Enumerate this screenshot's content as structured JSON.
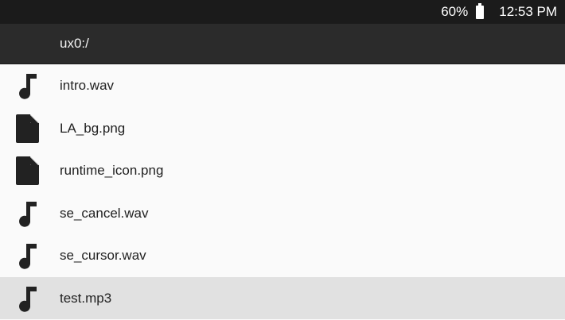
{
  "status_bar": {
    "battery_percent": "60%",
    "time": "12:53 PM",
    "battery_icon": "battery-icon"
  },
  "header": {
    "path": "ux0:/"
  },
  "files": [
    {
      "name": "intro.wav",
      "icon": "music-note-icon",
      "type": "audio",
      "selected": false
    },
    {
      "name": "LA_bg.png",
      "icon": "file-icon",
      "type": "file",
      "selected": false
    },
    {
      "name": "runtime_icon.png",
      "icon": "file-icon",
      "type": "file",
      "selected": false
    },
    {
      "name": "se_cancel.wav",
      "icon": "music-note-icon",
      "type": "audio",
      "selected": false
    },
    {
      "name": "se_cursor.wav",
      "icon": "music-note-icon",
      "type": "audio",
      "selected": false
    },
    {
      "name": "test.mp3",
      "icon": "music-note-icon",
      "type": "audio",
      "selected": true
    }
  ],
  "colors": {
    "status_bar_bg": "#1b1b1b",
    "title_bar_bg": "#2b2b2b",
    "list_bg": "#fafafa",
    "selected_row_bg": "#e1e1e1",
    "icon_color": "#222222"
  }
}
